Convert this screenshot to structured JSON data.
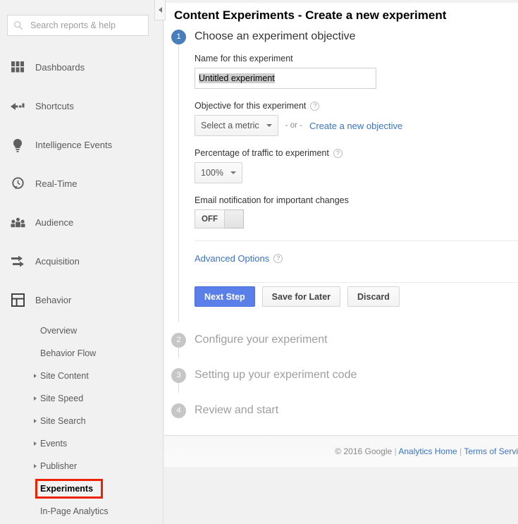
{
  "sidebar": {
    "search": {
      "placeholder": "Search reports & help",
      "value": "",
      "icon": "search-icon"
    },
    "items": [
      {
        "label": "Dashboards",
        "icon": "dashboards-grid-icon"
      },
      {
        "label": "Shortcuts",
        "icon": "shortcuts-arrow-icon"
      },
      {
        "label": "Intelligence Events",
        "icon": "lightbulb-icon"
      },
      {
        "label": "Real-Time",
        "icon": "realtime-clock-icon"
      },
      {
        "label": "Audience",
        "icon": "audience-people-icon"
      },
      {
        "label": "Acquisition",
        "icon": "acquisition-arrows-icon"
      },
      {
        "label": "Behavior",
        "icon": "behavior-layout-icon"
      }
    ],
    "behavior_subitems": [
      {
        "label": "Overview",
        "caret": false,
        "selected": false
      },
      {
        "label": "Behavior Flow",
        "caret": false,
        "selected": false
      },
      {
        "label": "Site Content",
        "caret": true,
        "selected": false
      },
      {
        "label": "Site Speed",
        "caret": true,
        "selected": false
      },
      {
        "label": "Site Search",
        "caret": true,
        "selected": false
      },
      {
        "label": "Events",
        "caret": true,
        "selected": false
      },
      {
        "label": "Publisher",
        "caret": true,
        "selected": false
      },
      {
        "label": "Experiments",
        "caret": false,
        "selected": true
      },
      {
        "label": "In-Page Analytics",
        "caret": false,
        "selected": false
      }
    ],
    "collapse_handle_icon": "chevron-left-icon",
    "highlight_color": "#ee2200"
  },
  "main": {
    "page_title": "Content Experiments - Create a new experiment",
    "steps": [
      {
        "number": "1",
        "title": "Choose an experiment objective",
        "state": "active"
      },
      {
        "number": "2",
        "title": "Configure your experiment",
        "state": "idle"
      },
      {
        "number": "3",
        "title": "Setting up your experiment code",
        "state": "idle"
      },
      {
        "number": "4",
        "title": "Review and start",
        "state": "idle"
      }
    ],
    "active_step_accent": "#4a7ebb",
    "form": {
      "name_label": "Name for this experiment",
      "name_value": "Untitled experiment",
      "objective_label": "Objective for this experiment",
      "objective_help": "?",
      "objective_select_value": "Select a metric",
      "or_text": "- or -",
      "create_objective_link": "Create a new objective",
      "traffic_label": "Percentage of traffic to experiment",
      "traffic_help": "?",
      "traffic_value": "100%",
      "email_label": "Email notification for important changes",
      "toggle_state": "OFF",
      "advanced_options": "Advanced Options",
      "advanced_help": "?"
    },
    "buttons": {
      "next": "Next Step",
      "save": "Save for Later",
      "discard": "Discard",
      "primary_color": "#5b7fe8"
    }
  },
  "footer": {
    "copyright": "© 2016 Google",
    "sep": "|",
    "analytics_home": "Analytics Home",
    "terms": "Terms of Servi"
  }
}
